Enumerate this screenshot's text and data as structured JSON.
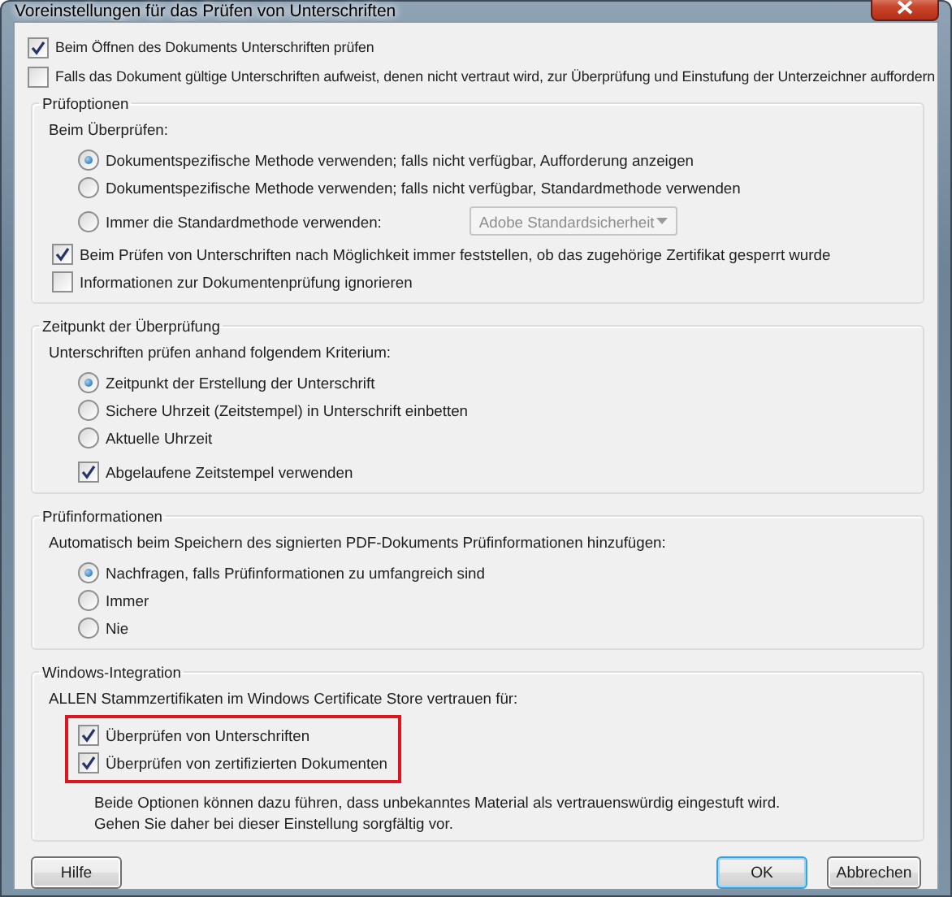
{
  "window": {
    "title": "Voreinstellungen für das Prüfen von Unterschriften"
  },
  "options": [
    {
      "label": "Beim Öffnen des Dokuments Unterschriften prüfen",
      "checked": true
    },
    {
      "label": "Falls das Dokument gültige Unterschriften aufweist, denen nicht vertraut wird, zur Überprüfung und Einstufung der Unterzeichner auffordern",
      "checked": false
    }
  ],
  "groups": [
    {
      "title": "Prüfoptionen",
      "items": [
        {
          "kind": "label",
          "text": "Beim Überprüfen:"
        },
        {
          "kind": "radio",
          "label": "Dokumentspezifische Methode verwenden; falls nicht verfügbar, Aufforderung anzeigen",
          "selected": true
        },
        {
          "kind": "radio",
          "label": "Dokumentspezifische Methode verwenden; falls nicht verfügbar, Standardmethode verwenden",
          "selected": false
        },
        {
          "kind": "radio-select",
          "label": "Immer die Standardmethode verwenden:",
          "selected": false,
          "select": {
            "value": "Adobe Standardsicherheit",
            "disabled": true
          }
        },
        {
          "kind": "checkbox",
          "label": "Beim Prüfen von Unterschriften nach Möglichkeit immer feststellen, ob das zugehörige Zertifikat gesperrt wurde",
          "checked": true
        },
        {
          "kind": "checkbox",
          "label": "Informationen zur Dokumentenprüfung ignorieren",
          "checked": false
        }
      ]
    },
    {
      "title": "Zeitpunkt der Überprüfung",
      "items": [
        {
          "kind": "label",
          "text": "Unterschriften prüfen anhand folgendem Kriterium:"
        },
        {
          "kind": "radio",
          "label": "Zeitpunkt der Erstellung der Unterschrift",
          "selected": true
        },
        {
          "kind": "radio",
          "label": "Sichere Uhrzeit (Zeitstempel) in Unterschrift einbetten",
          "selected": false
        },
        {
          "kind": "radio",
          "label": "Aktuelle Uhrzeit",
          "selected": false
        },
        {
          "kind": "sub-checkbox",
          "label": "Abgelaufene Zeitstempel verwenden",
          "checked": true
        }
      ]
    },
    {
      "title": "Prüfinformationen",
      "items": [
        {
          "kind": "label",
          "text": "Automatisch beim Speichern des signierten PDF-Dokuments Prüfinformationen hinzufügen:"
        },
        {
          "kind": "radio",
          "label": "Nachfragen, falls Prüfinformationen zu umfangreich sind",
          "selected": true
        },
        {
          "kind": "radio",
          "label": "Immer",
          "selected": false
        },
        {
          "kind": "radio",
          "label": "Nie",
          "selected": false
        }
      ]
    },
    {
      "title": "Windows-Integration",
      "items": [
        {
          "kind": "label",
          "text": "ALLEN Stammzertifikaten im Windows Certificate Store vertrauen für:"
        },
        {
          "kind": "checkbox-group",
          "highlighted": true,
          "items": [
            {
              "label": "Überprüfen von Unterschriften",
              "checked": true
            },
            {
              "label": "Überprüfen von zertifizierten Dokumenten",
              "checked": true
            }
          ]
        },
        {
          "kind": "note",
          "text": "Beide Optionen können dazu führen, dass unbekanntes Material als vertrauenswürdig eingestuft wird. Gehen Sie daher bei dieser Einstellung sorgfältig vor."
        }
      ]
    }
  ],
  "buttons": [
    {
      "label": "Hilfe",
      "default": false
    },
    {
      "label": "OK",
      "default": true
    },
    {
      "label": "Abbrechen",
      "default": false
    }
  ]
}
